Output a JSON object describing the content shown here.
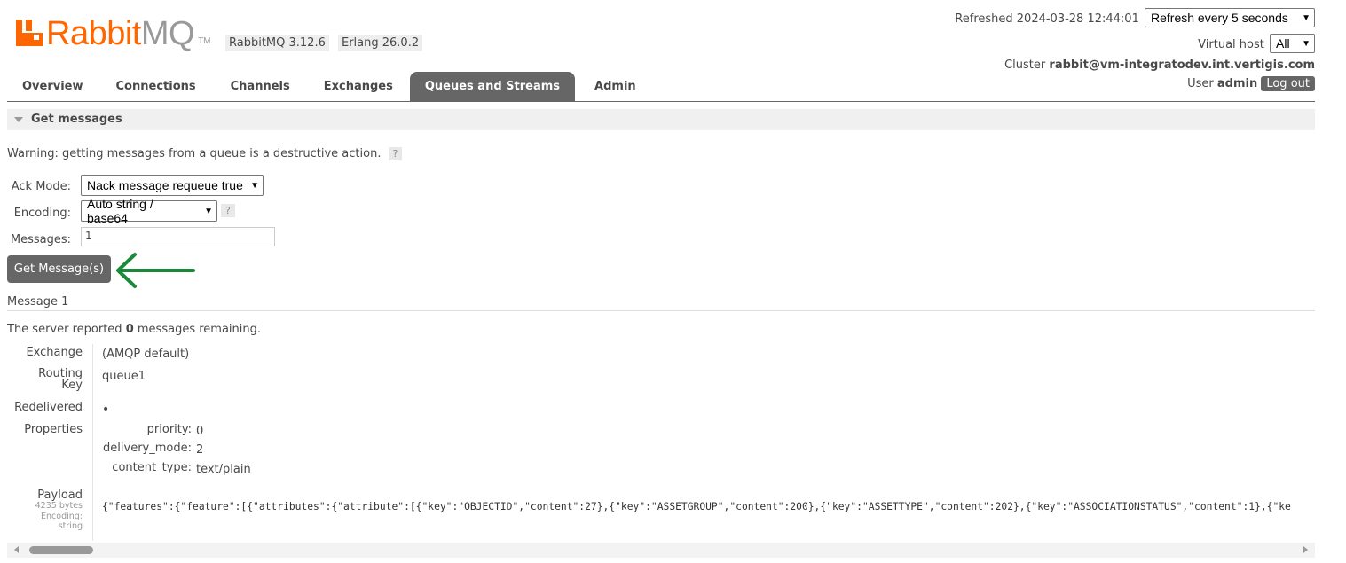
{
  "header": {
    "logo_text_rabbit": "Rabbit",
    "logo_text_mq": "MQ",
    "logo_tm": "TM",
    "version_rabbitmq": "RabbitMQ 3.12.6",
    "version_erlang": "Erlang 26.0.2",
    "refreshed_label": "Refreshed",
    "refreshed_time": "2024-03-28 12:44:01",
    "refresh_select_value": "Refresh every 5 seconds",
    "virtual_host_label": "Virtual host",
    "virtual_host_value": "All",
    "cluster_label": "Cluster",
    "cluster_value": "rabbit@vm-integratodev.int.vertigis.com",
    "user_label": "User",
    "user_value": "admin",
    "logout_label": "Log out"
  },
  "tabs": [
    {
      "label": "Overview"
    },
    {
      "label": "Connections"
    },
    {
      "label": "Channels"
    },
    {
      "label": "Exchanges"
    },
    {
      "label": "Queues and Streams",
      "active": true
    },
    {
      "label": "Admin"
    }
  ],
  "section": {
    "title": "Get messages",
    "warning": "Warning: getting messages from a queue is a destructive action.",
    "help": "?",
    "ack_mode_label": "Ack Mode:",
    "ack_mode_value": "Nack message requeue true",
    "encoding_label": "Encoding:",
    "encoding_value": "Auto string / base64",
    "messages_label": "Messages:",
    "messages_value": "1",
    "get_button": "Get Message(s)"
  },
  "result": {
    "message_heading": "Message 1",
    "server_report_prefix": "The server reported",
    "remaining_count": "0",
    "server_report_suffix": "messages remaining.",
    "fields": {
      "exchange_label": "Exchange",
      "exchange_value": "(AMQP default)",
      "routing_label_1": "Routing",
      "routing_label_2": "Key",
      "routing_value": "queue1",
      "redelivered_label": "Redelivered",
      "redelivered_value": "•",
      "properties_label": "Properties",
      "props": [
        {
          "key": "priority:",
          "value": "0"
        },
        {
          "key": "delivery_mode:",
          "value": "2"
        },
        {
          "key": "content_type:",
          "value": "text/plain"
        }
      ],
      "payload_label": "Payload",
      "payload_size": "4235 bytes",
      "payload_encoding_label": "Encoding:",
      "payload_encoding": "string",
      "payload_value": "{\"features\":{\"feature\":[{\"attributes\":{\"attribute\":[{\"key\":\"OBJECTID\",\"content\":27},{\"key\":\"ASSETGROUP\",\"content\":200},{\"key\":\"ASSETTYPE\",\"content\":202},{\"key\":\"ASSOCIATIONSTATUS\",\"content\":1},{\"ke"
    }
  },
  "colors": {
    "brand_orange": "#ff6600",
    "tab_active_bg": "#666666",
    "annotation_arrow": "#1a8a3a"
  }
}
